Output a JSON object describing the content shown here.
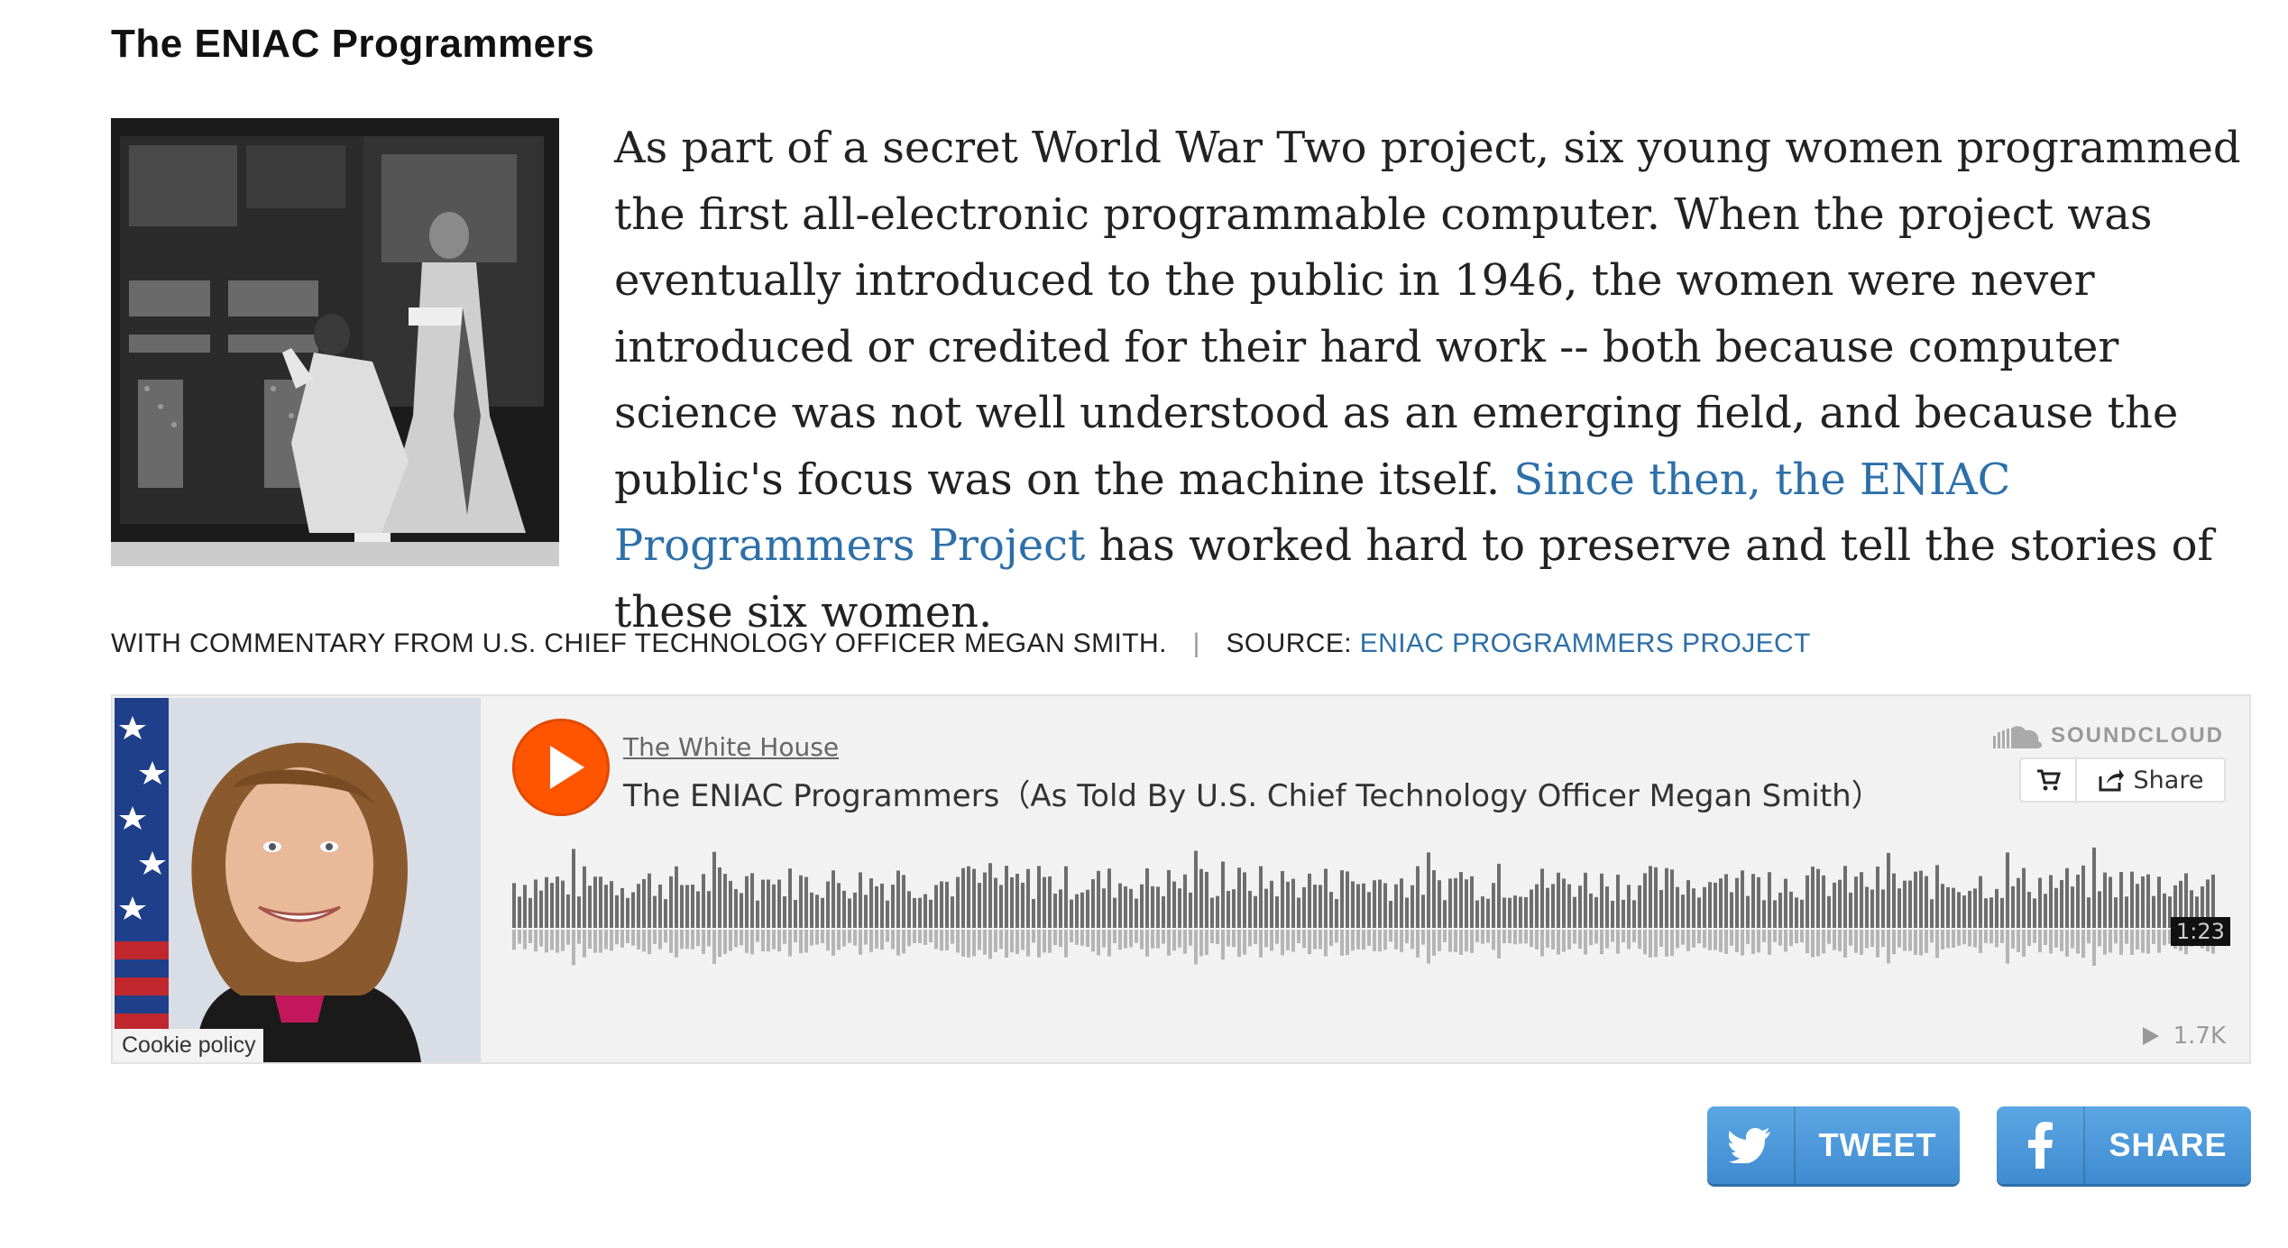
{
  "title": "The ENIAC Programmers",
  "body": {
    "text_before_link": "As part of a secret World War Two project, six young women programmed the first all-electronic programmable computer. When the project was eventually introduced to the public in 1946, the women were never introduced or credited for their hard work -- both because computer science was not well understood as an emerging field, and because the public's focus was on the machine itself. ",
    "link_text": "Since then, the ENIAC Programmers Project",
    "text_after_link": " has worked hard to preserve and tell the stories of these six women."
  },
  "meta": {
    "commentary": "WITH COMMENTARY FROM U.S. CHIEF TECHNOLOGY OFFICER MEGAN SMITH.",
    "separator": "|",
    "source_label": "SOURCE: ",
    "source_link": "ENIAC PROGRAMMERS PROJECT"
  },
  "player": {
    "user": "The White House",
    "track": "The ENIAC Programmers（As Told By U.S. Chief Technology Officer Megan Smith）",
    "brand": "SOUNDCLOUD",
    "share_label": "Share",
    "duration": "1:23",
    "plays": "1.7K",
    "cookie_policy": "Cookie policy",
    "accent_color": "#ff5500"
  },
  "social": {
    "tweet_label": "TWEET",
    "share_label": "SHARE",
    "button_color": "#4a97da"
  }
}
